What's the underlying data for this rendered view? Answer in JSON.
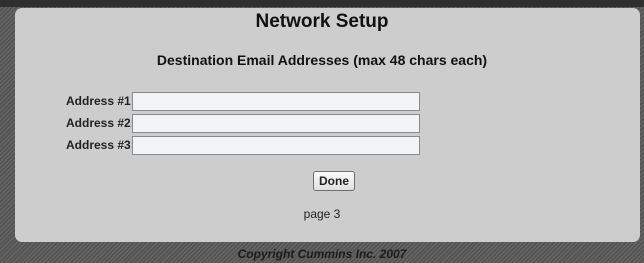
{
  "page": {
    "title": "Network Setup",
    "subtitle": "Destination Email Addresses (max 48 chars each)",
    "page_label": "page 3",
    "copyright": "Copyright Cummins Inc. 2007"
  },
  "form": {
    "address_1": {
      "label": "Address #1:",
      "value": "",
      "placeholder": ""
    },
    "address_2": {
      "label": "Address #2:",
      "value": "",
      "placeholder": ""
    },
    "address_3": {
      "label": "Address #3:",
      "value": "",
      "placeholder": ""
    },
    "done_label": "Done"
  },
  "colors": {
    "panel_background": "#cdcdcd",
    "page_background": "#5e5e5e",
    "input_background": "#f2f4f5"
  }
}
